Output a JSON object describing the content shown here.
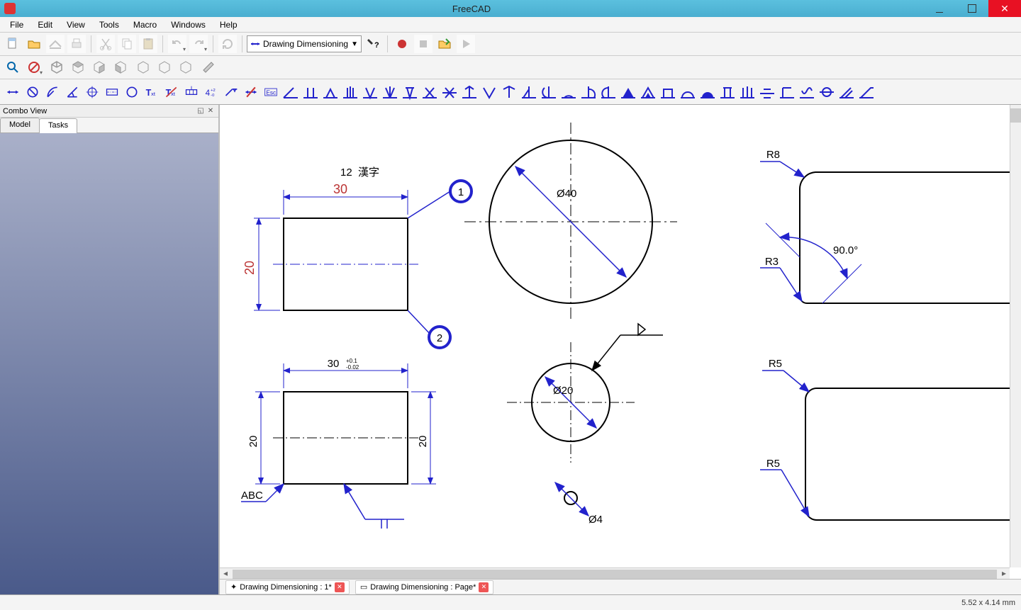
{
  "app": {
    "title": "FreeCAD"
  },
  "menu": {
    "file": "File",
    "edit": "Edit",
    "view": "View",
    "tools": "Tools",
    "macro": "Macro",
    "windows": "Windows",
    "help": "Help"
  },
  "workbench": {
    "selected": "Drawing Dimensioning"
  },
  "panel": {
    "title": "Combo View",
    "tabs": {
      "model": "Model",
      "tasks": "Tasks"
    }
  },
  "drawing": {
    "label_12": "12",
    "label_kanji": "漢字",
    "dim_30": "30",
    "dim_20": "20",
    "bubble_1": "1",
    "bubble_2": "2",
    "dim_30_tol": "30",
    "tol_upper": "+0.1",
    "tol_lower": "-0.02",
    "dim_20_left": "20",
    "dim_20_right": "20",
    "note_abc": "ABC",
    "dia_40": "Ø40",
    "dia_20": "Ø20",
    "dia_4": "Ø4",
    "r8": "R8",
    "r3": "R3",
    "r5_top": "R5",
    "r5_bot": "R5",
    "angle_90": "90.0°"
  },
  "doc_tabs": {
    "tab1": "Drawing Dimensioning : 1*",
    "tab2": "Drawing Dimensioning : Page*"
  },
  "status": {
    "coords": "5.52 x 4.14 mm"
  }
}
